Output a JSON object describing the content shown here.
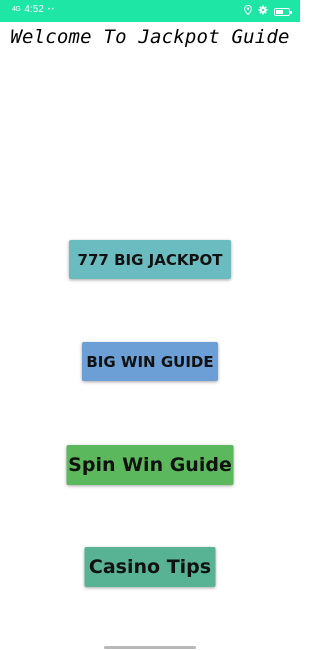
{
  "status_bar": {
    "signal": "4G",
    "time": "4:52",
    "dots": "• •",
    "location_icon": "location-pin-icon",
    "settings_icon": "gear-icon",
    "battery_icon": "battery-icon",
    "battery_level": 0.6,
    "background_color": "#1ee6a5"
  },
  "header": {
    "title": "Welcome To Jackpot Guide"
  },
  "buttons": [
    {
      "label": "777 BIG JACKPOT",
      "color": "#6bbcc0"
    },
    {
      "label": "BIG WIN GUIDE",
      "color": "#6c9fd6"
    },
    {
      "label": "Spin Win Guide",
      "color": "#5cb85c"
    },
    {
      "label": "Casino Tips",
      "color": "#57b394"
    }
  ]
}
